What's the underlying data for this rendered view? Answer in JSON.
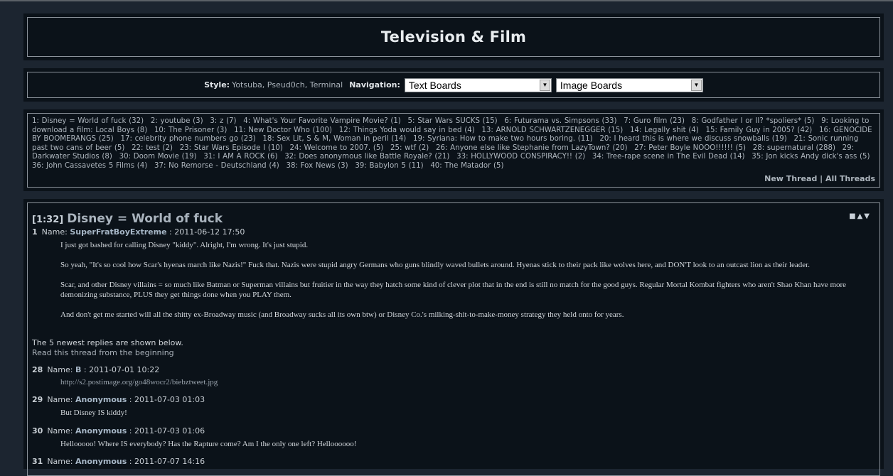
{
  "page": {
    "title": "Television & Film"
  },
  "nav": {
    "style_label": "Style:",
    "styles": [
      "Yotsuba",
      "Pseud0ch",
      "Terminal"
    ],
    "navigation_label": "Navigation:",
    "select1": "Text Boards",
    "select2": "Image Boards"
  },
  "threads": [
    "1: Disney = World of fuck (32)",
    "2: youtube (3)",
    "3: z (7)",
    "4: What's Your Favorite Vampire Movie? (1)",
    "5: Star Wars SUCKS (15)",
    "6: Futurama vs. Simpsons (33)",
    "7: Guro film (23)",
    "8: Godfather I or II? *spoliers* (5)",
    "9: Looking to download a film: Local Boys (8)",
    "10: The Prisoner (3)",
    "11: New Doctor Who (100)",
    "12: Things Yoda would say in bed (4)",
    "13: ARNOLD SCHWARTZENEGGER (15)",
    "14: Legally shit (4)",
    "15: Family Guy in 2005? (42)",
    "16: GENOCIDE BY BOOMERANGS (25)",
    "17: celebrity phone numbers go (23)",
    "18: Sex Lit, S & M, Woman in peril (14)",
    "19: Syriana: How to make two hours boring. (11)",
    "20: I heard this is where we discuss snowballs (19)",
    "21: Sonic running past two cans of beer (5)",
    "22: test (2)",
    "23: Star Wars Episode I (10)",
    "24: Welcome to 2007. (5)",
    "25: wtf (2)",
    "26: Anyone else like Stephanie from LazyTown? (20)",
    "27: Peter Boyle NOOO!!!!!! (5)",
    "28: supernatural (288)",
    "29: Darkwater Studios (8)",
    "30: Doom Movie (19)",
    "31: I AM A ROCK (6)",
    "32: Does anonymous like Battle Royale? (21)",
    "33: HOLLYWOOD CONSPIRACY!! (2)",
    "34: Tree-rape scene in The Evil Dead (14)",
    "35: Jon kicks Andy dick's ass (5)",
    "36: John Cassavetes 5 Films (4)",
    "37: No Remorse - Deutschland (4)",
    "38: Fox News (3)",
    "39: Babylon 5 (11)",
    "40: The Matador (5)"
  ],
  "list_actions": {
    "new_thread": "New Thread",
    "separator": "|",
    "all_threads": "All Threads"
  },
  "thread": {
    "num": "[1:32]",
    "title": "Disney = World of fuck",
    "controls": "■▲▼",
    "replies_note": "The 5 newest replies are shown below.",
    "read_from_beginning": "Read this thread from the beginning",
    "posts": [
      {
        "num": "1",
        "name_label": "Name:",
        "name": "SuperFratBoyExtreme",
        "date": ": 2011-06-12 17:50",
        "paragraphs": [
          "I just got bashed for calling Disney \"kiddy\".  Alright, I'm wrong.  It's just stupid.",
          "So yeah, \"It's so cool how Scar's hyenas march like Nazis!\"  Fuck that.  Nazis were stupid angry Germans who guns blindly waved bullets around.  Hyenas stick to their pack like wolves here, and DON'T look to an outcast lion as their leader.",
          "Scar, and other Disney villains = so much like Batman or Superman villains but fruitier in the way they hatch some kind of clever plot that in the end is still no match for the good guys.  Regular Mortal Kombat fighters who aren't Shao Khan have more demonizing substance, PLUS they get things done when you PLAY them.",
          "And don't get me started will all the shitty ex-Broadway music (and Broadway sucks all its own btw) or Disney Co.'s milking-shit-to-make-money strategy they held onto for years."
        ]
      },
      {
        "num": "28",
        "name_label": "Name:",
        "name": "B",
        "date": ": 2011-07-01 10:22",
        "paragraphs": [
          "http://s2.postimage.org/go48wocr2/biebztweet.jpg"
        ]
      },
      {
        "num": "29",
        "name_label": "Name:",
        "name": "Anonymous",
        "date": ": 2011-07-03 01:03",
        "paragraphs": [
          "But Disney IS kiddy!"
        ]
      },
      {
        "num": "30",
        "name_label": "Name:",
        "name": "Anonymous",
        "date": ": 2011-07-03 01:06",
        "paragraphs": [
          "Hellooooo! Where IS everybody? Has the Rapture come? Am I the only one left? Helloooooo!"
        ]
      },
      {
        "num": "31",
        "name_label": "Name:",
        "name": "Anonymous",
        "date": ": 2011-07-07 14:16",
        "paragraphs": []
      }
    ]
  }
}
